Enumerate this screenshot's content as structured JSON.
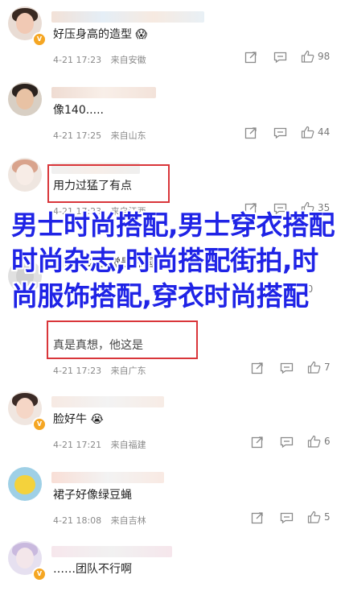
{
  "comments": [
    {
      "text": "好压身高的造型 😱",
      "time": "4-21 17:23",
      "location": "来自安徽",
      "likes": "98"
    },
    {
      "text": "像140.....",
      "time": "4-21 17:25",
      "location": "来自山东",
      "likes": "44"
    },
    {
      "text": "用力过猛了有点",
      "time": "4-21 17:23",
      "location": "来自江西",
      "likes": "35"
    },
    {
      "text": "西瓜这么感觉是韩国造了",
      "time": "4-21 17:24",
      "location": "来自浙江",
      "likes": "20"
    },
    {
      "text": "真是真想，他这是",
      "time": "4-21 17:23",
      "location": "来自广东",
      "likes": "7"
    },
    {
      "text": "脸好牛 😭",
      "time": "4-21 17:21",
      "location": "来自福建",
      "likes": "6"
    },
    {
      "text": "裙子好像绿豆蝇",
      "time": "4-21 18:08",
      "location": "来自吉林",
      "likes": "5"
    },
    {
      "text": "……团队不行啊",
      "time": "",
      "location": "",
      "likes": ""
    }
  ],
  "overlay_title": "男士时尚搭配,男士穿衣搭配时尚杂志,时尚搭配街拍,时尚服饰搭配,穿衣时尚搭配",
  "colors": {
    "overlay": "#1f23e6",
    "highlight": "#d9363a",
    "badge": "#f5a623"
  },
  "icons": {
    "share": "share-icon",
    "reply": "comment-icon",
    "like": "thumbs-up-icon",
    "badge": "verified-v-icon"
  }
}
